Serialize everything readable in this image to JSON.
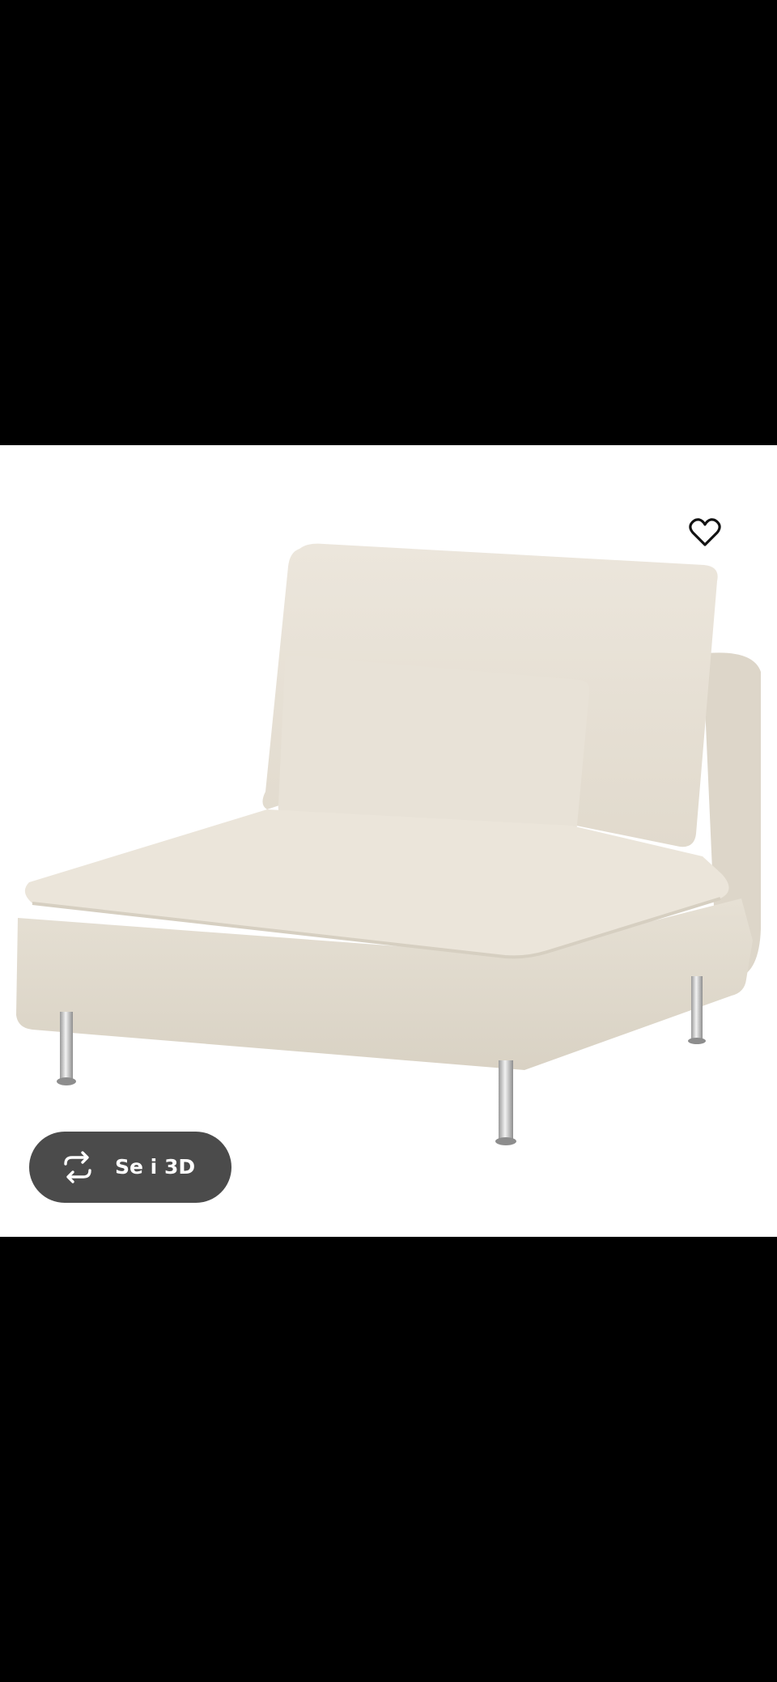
{
  "viewer": {
    "background_color": "#ffffff",
    "page_background_color": "#000000",
    "product_image": {
      "icon": "armchair-module-image",
      "fabric_color": "#e7e1d6"
    },
    "favorite_button": {
      "icon": "heart-outline-icon"
    },
    "view_3d_button": {
      "icon": "rotate-arrows-icon",
      "label": "Se i 3D",
      "background_color": "#4b4b4b"
    }
  }
}
